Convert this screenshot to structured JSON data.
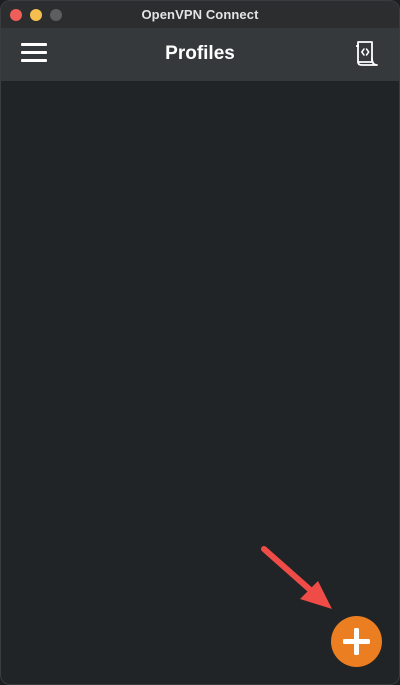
{
  "window": {
    "title": "OpenVPN Connect"
  },
  "header": {
    "title": "Profiles",
    "menu_icon": "hamburger-menu-icon",
    "import_icon": "import-profile-icon"
  },
  "fab": {
    "icon": "plus-icon",
    "color": "#ec7e22"
  },
  "annotation": {
    "icon": "arrow-icon",
    "color": "#ef4b47"
  },
  "colors": {
    "header_bg": "#35393b",
    "content_bg": "#202426"
  }
}
